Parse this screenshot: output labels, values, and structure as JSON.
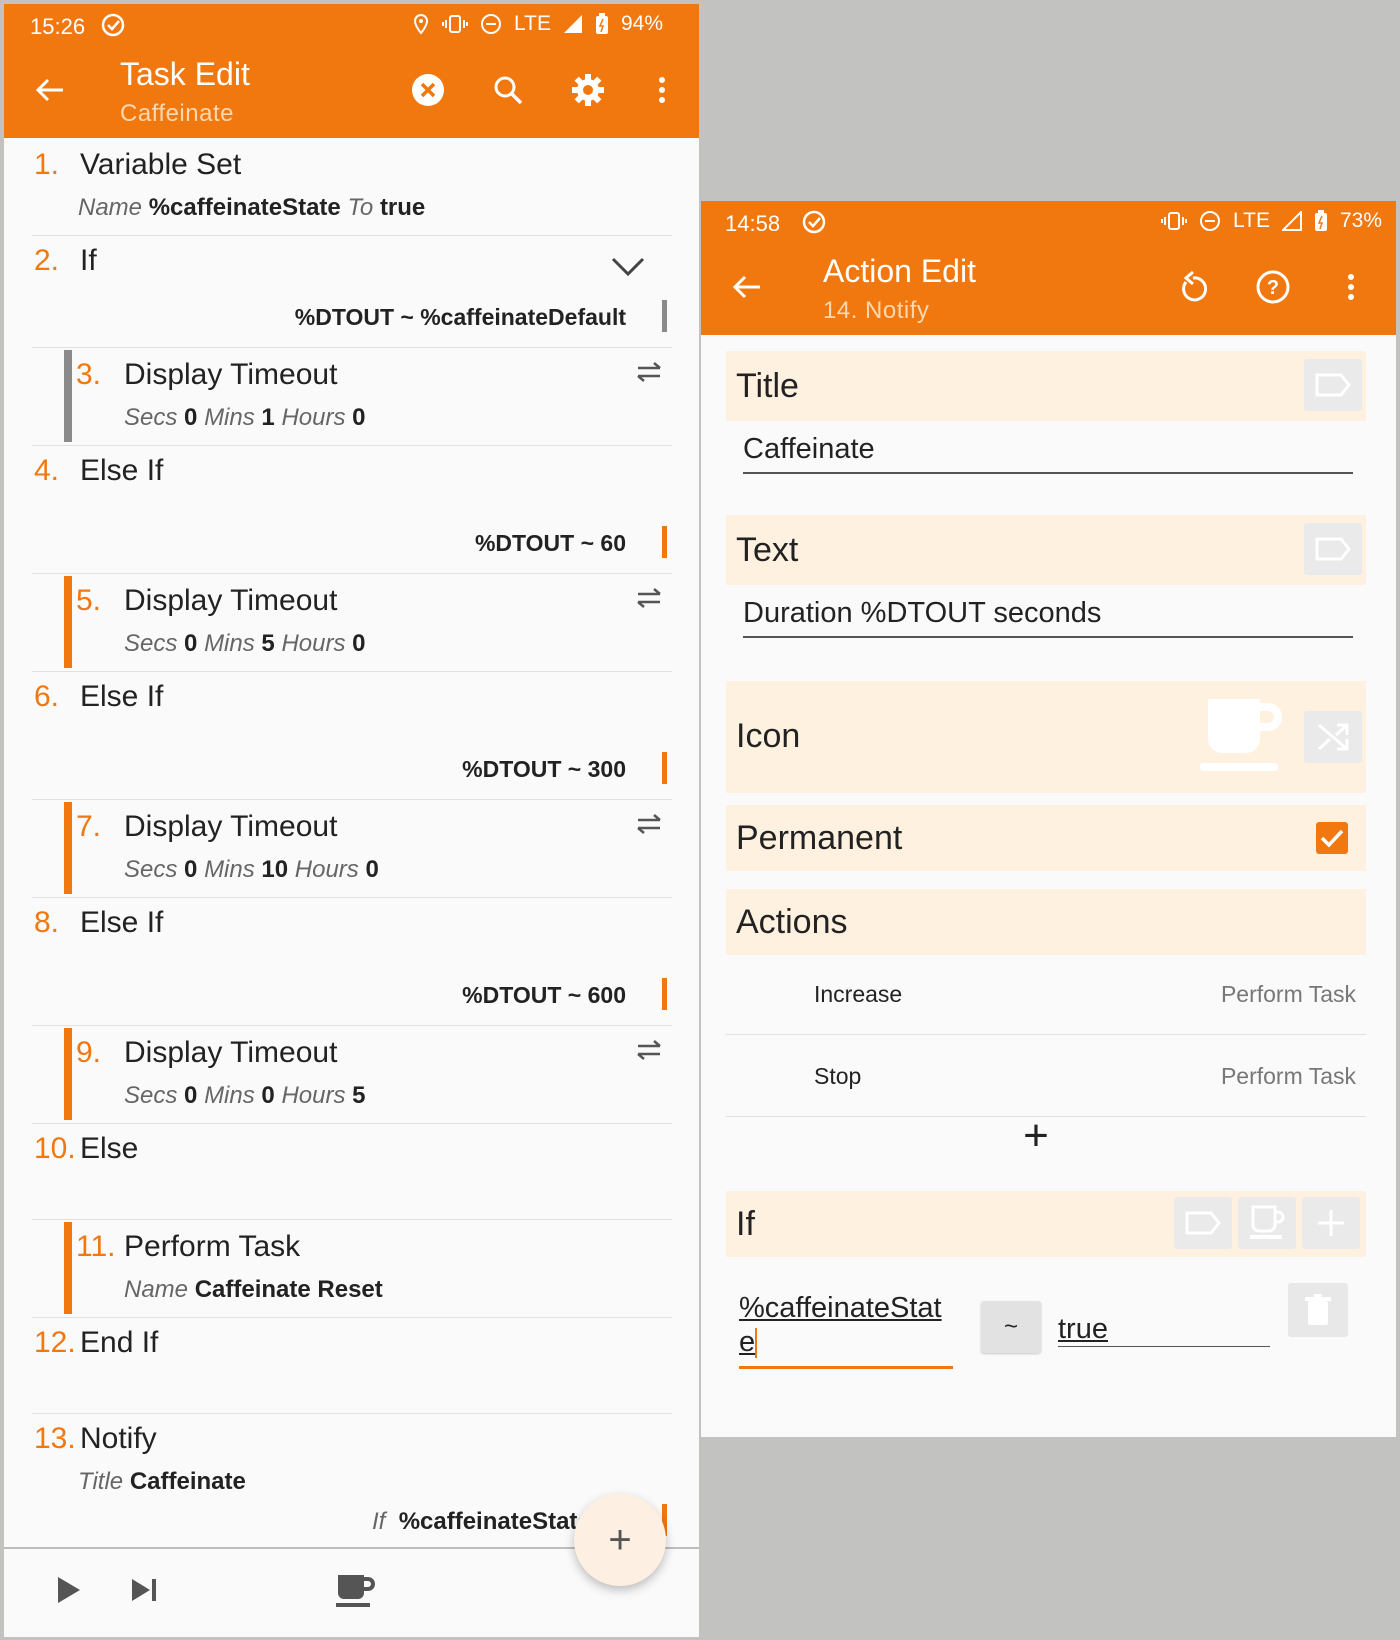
{
  "left": {
    "status": {
      "time": "15:26",
      "net": "LTE",
      "battery": "94%"
    },
    "toolbar": {
      "title": "Task Edit",
      "subtitle": "Caffeinate"
    },
    "rows": [
      {
        "num": "1.",
        "name": "Variable Set",
        "args": [
          {
            "k": "Name",
            "v": "%caffeinateState"
          },
          {
            "k": "To",
            "v": "true"
          }
        ]
      },
      {
        "num": "2.",
        "name": "If",
        "cond": "%DTOUT ~ %caffeinateDefault"
      },
      {
        "num": "3.",
        "name": "Display Timeout",
        "args": [
          {
            "k": "Secs",
            "v": "0"
          },
          {
            "k": "Mins",
            "v": "1"
          },
          {
            "k": "Hours",
            "v": "0"
          }
        ]
      },
      {
        "num": "4.",
        "name": "Else If",
        "cond": "%DTOUT ~ 60"
      },
      {
        "num": "5.",
        "name": "Display Timeout",
        "args": [
          {
            "k": "Secs",
            "v": "0"
          },
          {
            "k": "Mins",
            "v": "5"
          },
          {
            "k": "Hours",
            "v": "0"
          }
        ]
      },
      {
        "num": "6.",
        "name": "Else If",
        "cond": "%DTOUT ~ 300"
      },
      {
        "num": "7.",
        "name": "Display Timeout",
        "args": [
          {
            "k": "Secs",
            "v": "0"
          },
          {
            "k": "Mins",
            "v": "10"
          },
          {
            "k": "Hours",
            "v": "0"
          }
        ]
      },
      {
        "num": "8.",
        "name": "Else If",
        "cond": "%DTOUT ~ 600"
      },
      {
        "num": "9.",
        "name": "Display Timeout",
        "args": [
          {
            "k": "Secs",
            "v": "0"
          },
          {
            "k": "Mins",
            "v": "0"
          },
          {
            "k": "Hours",
            "v": "5"
          }
        ]
      },
      {
        "num": "10.",
        "name": "Else"
      },
      {
        "num": "11.",
        "name": "Perform Task",
        "args": [
          {
            "k": "Name",
            "v": "Caffeinate Reset"
          }
        ]
      },
      {
        "num": "12.",
        "name": "End If"
      },
      {
        "num": "13.",
        "name": "Notify",
        "args": [
          {
            "k": "Title",
            "v": "Caffeinate"
          }
        ],
        "if_k": "If",
        "if_v": "%caffeinateState"
      }
    ],
    "fab": "+"
  },
  "right": {
    "status": {
      "time": "14:58",
      "net": "LTE",
      "battery": "73%"
    },
    "toolbar": {
      "title": "Action Edit",
      "subtitle": "14. Notify"
    },
    "title_label": "Title",
    "title_value": "Caffeinate",
    "text_label": "Text",
    "text_value": "Duration %DTOUT seconds",
    "icon_label": "Icon",
    "permanent_label": "Permanent",
    "permanent_checked": true,
    "actions_label": "Actions",
    "actions": [
      {
        "name": "Increase",
        "value": "Perform Task"
      },
      {
        "name": "Stop",
        "value": "Perform Task"
      }
    ],
    "add": "+",
    "if_label": "If",
    "if_left_1": "%caffeinateStat",
    "if_left_2": "e",
    "if_op": "~",
    "if_right": "true"
  },
  "colors": {
    "accent": "#f0780f",
    "section_bg": "#fff1e0",
    "page_bg": "#fafafa"
  }
}
